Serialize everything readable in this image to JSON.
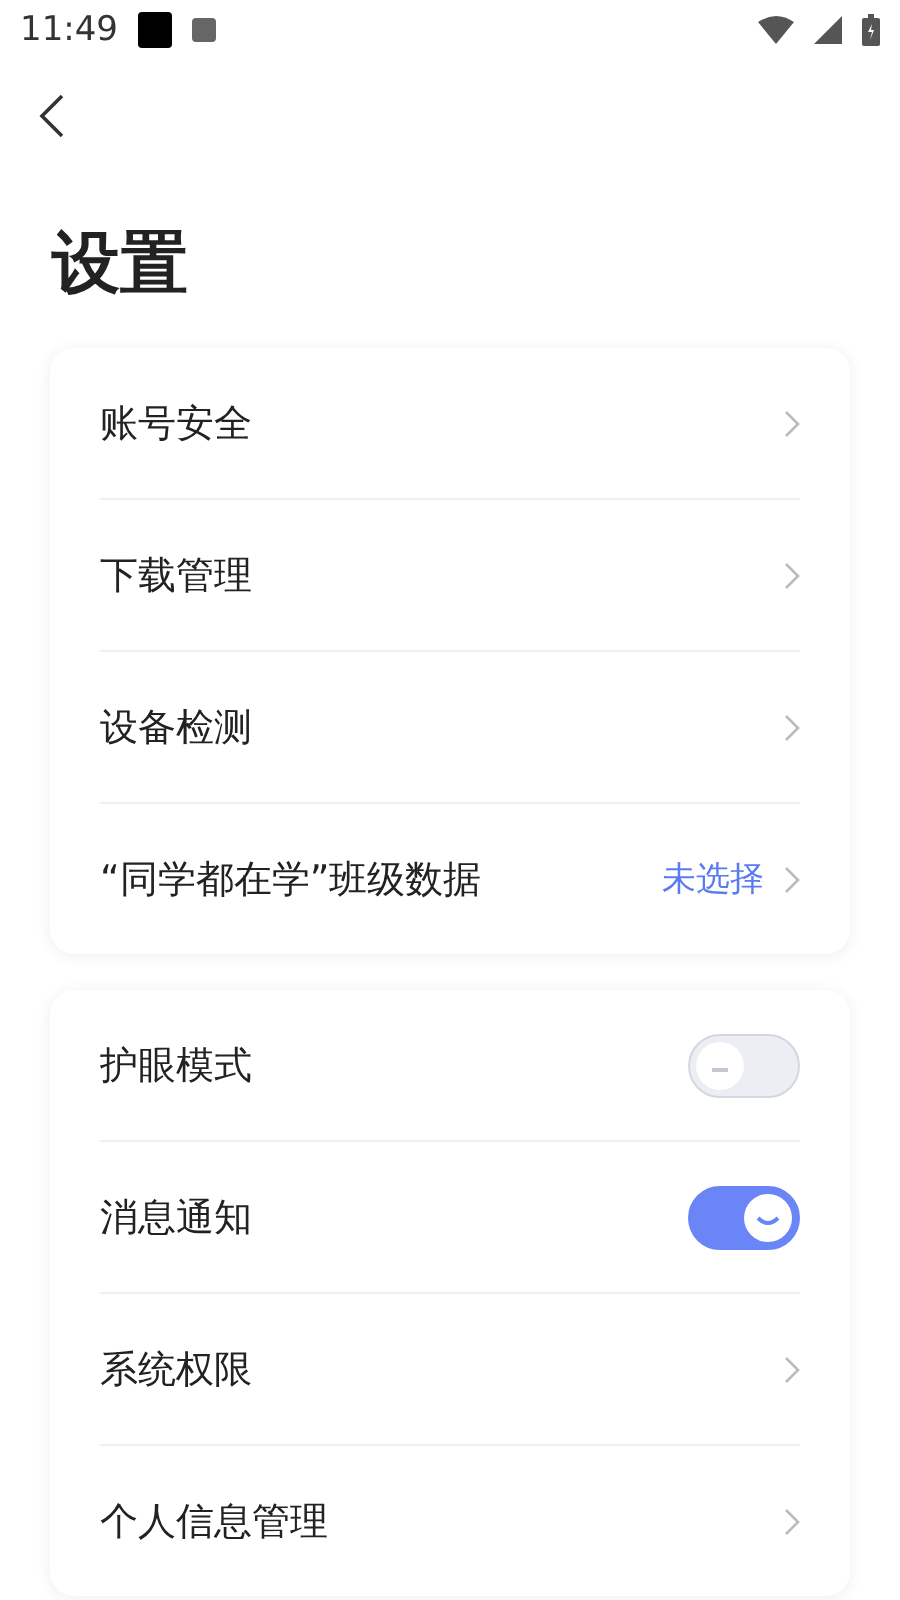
{
  "status_bar": {
    "time": "11:49"
  },
  "title": "设置",
  "groups": [
    {
      "items": [
        {
          "kind": "link",
          "label": "账号安全"
        },
        {
          "kind": "link",
          "label": "下载管理"
        },
        {
          "kind": "link",
          "label": "设备检测"
        },
        {
          "kind": "link",
          "label": "“同学都在学”班级数据",
          "value": "未选择"
        }
      ]
    },
    {
      "items": [
        {
          "kind": "toggle",
          "label": "护眼模式",
          "on": false
        },
        {
          "kind": "toggle",
          "label": "消息通知",
          "on": true
        },
        {
          "kind": "link",
          "label": "系统权限"
        },
        {
          "kind": "link",
          "label": "个人信息管理"
        }
      ]
    }
  ]
}
